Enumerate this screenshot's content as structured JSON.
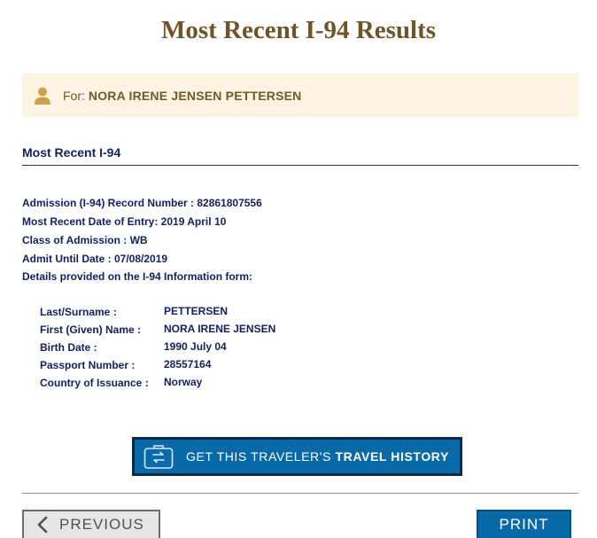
{
  "page": {
    "title": "Most Recent I-94 Results"
  },
  "banner": {
    "for_label": "For:",
    "traveler_name": "NORA IRENE JENSEN PETTERSEN",
    "icon": "user-icon"
  },
  "record": {
    "heading": "Most Recent I-94",
    "lines": [
      "Admission (I-94) Record Number : 82861807556",
      "Most Recent Date of Entry: 2019 April 10",
      "Class of Admission : WB",
      "Admit Until Date : 07/08/2019",
      "Details provided on the I-94 Information form:"
    ],
    "details": [
      {
        "label": "Last/Surname :",
        "value": "PETTERSEN"
      },
      {
        "label": "First (Given) Name :",
        "value": "NORA IRENE JENSEN"
      },
      {
        "label": "Birth Date :",
        "value": "1990 July 04"
      },
      {
        "label": "Passport Number :",
        "value": "28557164"
      },
      {
        "label": "Country of Issuance :",
        "value": "Norway"
      }
    ]
  },
  "actions": {
    "travel_history_prefix": "GET THIS TRAVELER'S",
    "travel_history_bold": "TRAVEL HISTORY",
    "travel_history_icon": "suitcase-icon",
    "previous_label": "PREVIOUS",
    "previous_icon": "chevron-left-icon",
    "print_label": "PRINT"
  },
  "colors": {
    "title": "#6f5428",
    "banner_bg": "#fcf3e2",
    "text_navy": "#14205e",
    "button_blue": "#0a6aa8"
  }
}
